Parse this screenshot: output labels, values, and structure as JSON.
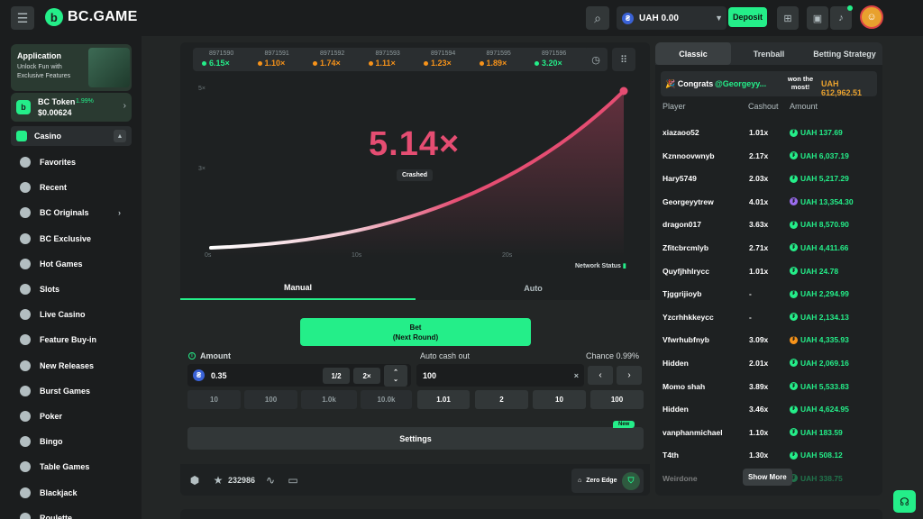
{
  "header": {
    "brand": "BC.GAME",
    "brand_letter": "b",
    "wallet_currency": "UAH",
    "wallet_balance": "UAH 0.00",
    "deposit_label": "Deposit"
  },
  "sidebar": {
    "app_card": {
      "title": "Application",
      "subtitle": "Unlock Fun with Exclusive Features"
    },
    "token": {
      "name": "BC Token",
      "change": "1.99%",
      "price": "$0.00624"
    },
    "casino_label": "Casino",
    "items": [
      {
        "label": "Favorites",
        "icon": "star-icon"
      },
      {
        "label": "Recent",
        "icon": "clock-icon"
      },
      {
        "label": "BC Originals",
        "icon": "bc-originals-icon",
        "has_more": true
      },
      {
        "label": "BC Exclusive",
        "icon": "exclusive-icon"
      },
      {
        "label": "Hot Games",
        "icon": "fire-icon"
      },
      {
        "label": "Slots",
        "icon": "slots-icon"
      },
      {
        "label": "Live Casino",
        "icon": "live-casino-icon"
      },
      {
        "label": "Feature Buy-in",
        "icon": "feature-buy-icon"
      },
      {
        "label": "New Releases",
        "icon": "rocket-icon"
      },
      {
        "label": "Burst Games",
        "icon": "burst-icon"
      },
      {
        "label": "Poker",
        "icon": "poker-icon"
      },
      {
        "label": "Bingo",
        "icon": "bingo-icon"
      },
      {
        "label": "Table Games",
        "icon": "table-games-icon"
      },
      {
        "label": "Blackjack",
        "icon": "blackjack-icon"
      },
      {
        "label": "Roulette",
        "icon": "roulette-icon"
      }
    ]
  },
  "history": [
    {
      "id": "8971590",
      "mult": "6.15×",
      "color": "#24ee89"
    },
    {
      "id": "8971591",
      "mult": "1.10×",
      "color": "#f7931a"
    },
    {
      "id": "8971592",
      "mult": "1.74×",
      "color": "#f7931a"
    },
    {
      "id": "8971593",
      "mult": "1.11×",
      "color": "#f7931a"
    },
    {
      "id": "8971594",
      "mult": "1.23×",
      "color": "#f7931a"
    },
    {
      "id": "8971595",
      "mult": "1.89×",
      "color": "#f7931a"
    },
    {
      "id": "8971596",
      "mult": "3.20×",
      "color": "#24ee89"
    }
  ],
  "game": {
    "multiplier": "5.14×",
    "status": "Crashed",
    "network_status": "Network Status",
    "y_ticks": [
      "5×",
      "3×"
    ],
    "x_ticks": [
      "0s",
      "10s",
      "20s"
    ],
    "tabs": [
      "Manual",
      "Auto"
    ],
    "bet_label": "Bet",
    "bet_sublabel": "(Next Round)",
    "amount_label": "Amount",
    "amount_value": "0.35",
    "half_label": "1/2",
    "double_label": "2×",
    "amount_presets": [
      "10",
      "100",
      "1.0k",
      "10.0k"
    ],
    "autocash_label": "Auto cash out",
    "autocash_value": "100",
    "chance_label": "Chance 0.99%",
    "autocash_presets": [
      "1.01",
      "2",
      "10",
      "100"
    ],
    "settings_label": "Settings",
    "new_badge": "New",
    "favorites_count": "232986",
    "zero_edge_label": "Zero Edge"
  },
  "rightpanel": {
    "tabs": [
      "Classic",
      "Trenball",
      "Betting Strategy"
    ],
    "congrats": {
      "label": "Congrats",
      "user": "@Georgeyy...",
      "text": "won the most!",
      "amount": "UAH 612,962.51"
    },
    "columns": [
      "Player",
      "Cashout",
      "Amount"
    ],
    "rows": [
      {
        "player": "xiazaoo52",
        "cashout": "1.01x",
        "amount": "UAH 137.69"
      },
      {
        "player": "Kznnoovwnyb",
        "cashout": "2.17x",
        "amount": "UAH 6,037.19"
      },
      {
        "player": "Hary5749",
        "cashout": "2.03x",
        "amount": "UAH 5,217.29"
      },
      {
        "player": "Georgeyytrew",
        "cashout": "4.01x",
        "amount": "UAH 13,354.30"
      },
      {
        "player": "dragon017",
        "cashout": "3.63x",
        "amount": "UAH 8,570.90"
      },
      {
        "player": "Zfitcbrcmlyb",
        "cashout": "2.71x",
        "amount": "UAH 4,411.66"
      },
      {
        "player": "Quyfjhhlrycc",
        "cashout": "1.01x",
        "amount": "UAH 24.78"
      },
      {
        "player": "Tjggrijioyb",
        "cashout": "-",
        "amount": "UAH 2,294.99"
      },
      {
        "player": "Yzcrhhkkeycc",
        "cashout": "-",
        "amount": "UAH 2,134.13"
      },
      {
        "player": "Vfwrhubfnyb",
        "cashout": "3.09x",
        "amount": "UAH 4,335.93"
      },
      {
        "player": "Hidden",
        "cashout": "2.01x",
        "amount": "UAH 2,069.16"
      },
      {
        "player": "Momo shah",
        "cashout": "3.89x",
        "amount": "UAH 5,533.83"
      },
      {
        "player": "Hidden",
        "cashout": "3.46x",
        "amount": "UAH 4,624.95"
      },
      {
        "player": "vanphanmichael",
        "cashout": "1.10x",
        "amount": "UAH 183.59"
      },
      {
        "player": "T4th",
        "cashout": "1.30x",
        "amount": "UAH 508.12"
      },
      {
        "player": "Weirdone",
        "cashout": "",
        "amount": "UAH 338.75"
      }
    ],
    "show_more": "Show More"
  },
  "colors": {
    "accent": "#24ee89",
    "crash": "#e54d72",
    "orange": "#f7931a"
  }
}
